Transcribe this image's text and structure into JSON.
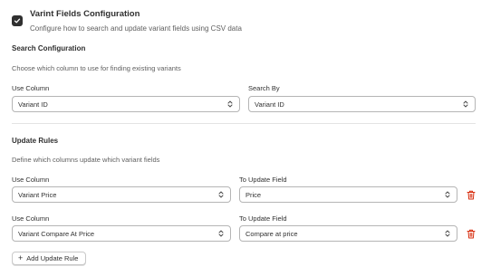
{
  "header": {
    "checked": true,
    "title": "Varint Fields Configuration",
    "subtitle": "Configure how to search and update variant fields using CSV data"
  },
  "search": {
    "title": "Search Configuration",
    "description": "Choose which column to use for finding existing variants",
    "use_column_label": "Use Column",
    "use_column_value": "Variant ID",
    "search_by_label": "Search By",
    "search_by_value": "Variant ID"
  },
  "update": {
    "title": "Update Rules",
    "description": "Define which columns update which variant fields",
    "rules": [
      {
        "column_label": "Use Column",
        "column_value": "Variant Price",
        "field_label": "To Update Field",
        "field_value": "Price"
      },
      {
        "column_label": "Use Column",
        "column_value": "Variant Compare At Price",
        "field_label": "To Update Field",
        "field_value": "Compare at price"
      }
    ],
    "add_label": "Add Update Rule"
  },
  "colors": {
    "delete_icon": "#d72c0d",
    "checkbox": "#303030"
  },
  "icons": [
    "checkmark-icon",
    "select-chevron-icon",
    "trash-icon",
    "plus-icon"
  ]
}
